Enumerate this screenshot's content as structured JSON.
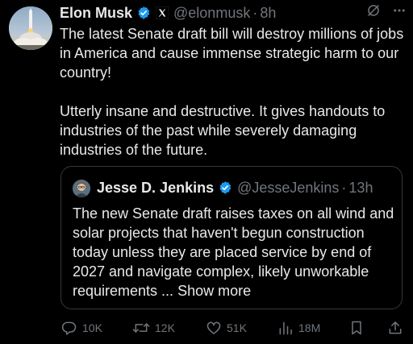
{
  "post": {
    "author_name": "Elon Musk",
    "handle": "@elonmusk",
    "separator": "·",
    "time": "8h",
    "text": "The latest Senate draft bill will destroy millions of jobs in America and cause immense strategic harm to our country!\n\nUtterly insane and destructive. It gives handouts to industries of the past while severely damaging industries of the future."
  },
  "quoted_post": {
    "author_name": "Jesse D. Jenkins",
    "handle": "@JesseJenkins",
    "separator": "·",
    "time": "13h",
    "text": "The new Senate draft raises taxes on all wind and solar projects that haven't begun construction today unless they are placed service by end of 2027 and navigate complex, likely unworkable requirements",
    "ellipsis": " ... ",
    "show_more": "Show more"
  },
  "actions": {
    "replies": "10K",
    "reposts": "12K",
    "likes": "51K",
    "views": "18M"
  },
  "colors": {
    "background": "#000000",
    "text": "#e7e9ea",
    "secondary": "#71767b",
    "verified": "#1d9bf0",
    "border": "#333639"
  },
  "icons": {
    "verified": "verified-badge-icon",
    "x_logo": "x-logo-icon",
    "grok": "grok-icon",
    "more": "more-icon",
    "reply": "reply-icon",
    "repost": "repost-icon",
    "like": "like-icon",
    "views": "views-icon",
    "bookmark": "bookmark-icon",
    "share": "share-icon"
  }
}
